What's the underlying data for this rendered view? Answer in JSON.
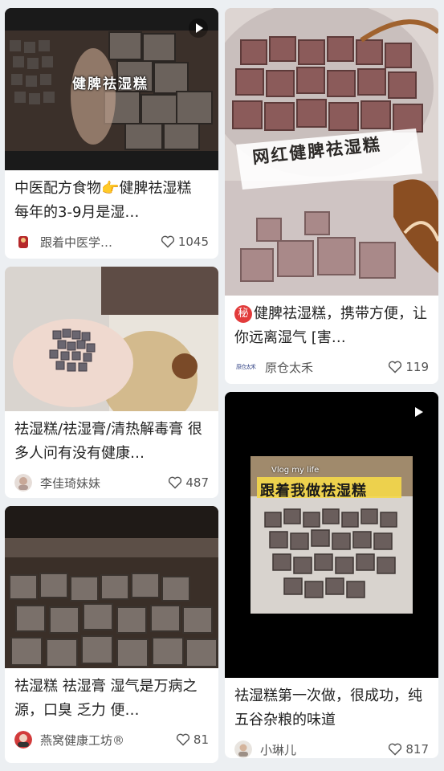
{
  "feed": {
    "cards": [
      {
        "overlay": "健脾祛湿糕",
        "title": "中医配方食物",
        "title_emoji": "👉",
        "title_rest": "健脾祛湿糕 每年的3-9月是湿…",
        "author": "跟着中医学…",
        "likes": "1045",
        "has_video": true
      },
      {
        "title": "祛湿糕/祛湿膏/清热解毒膏 很多人问有没有健康…",
        "author": "李佳琦妹妹",
        "likes": "487",
        "has_video": false
      },
      {
        "title": "祛湿糕 祛湿膏 湿气是万病之源，口臭 乏力 便…",
        "author": "燕窝健康工坊®",
        "likes": "81",
        "has_video": false
      },
      {
        "overlay": "网红健脾祛湿糕",
        "badge": "秘",
        "title": "健脾祛湿糕，携带方便，让你远离湿气 [害…",
        "author": "原仓太禾",
        "author_logo_text": "原仓太禾",
        "likes": "119",
        "has_video": false
      },
      {
        "overlay_small": "Vlog my life",
        "overlay": "跟着我做祛湿糕",
        "title": "祛湿糕第一次做，很成功，纯五谷杂粮的味道",
        "author": "小琳儿",
        "likes": "817",
        "has_video": true
      }
    ]
  },
  "colors": {
    "background": "#eceff2",
    "card": "#ffffff",
    "text": "#222222",
    "meta": "#555555",
    "badge": "#e23b3b"
  }
}
